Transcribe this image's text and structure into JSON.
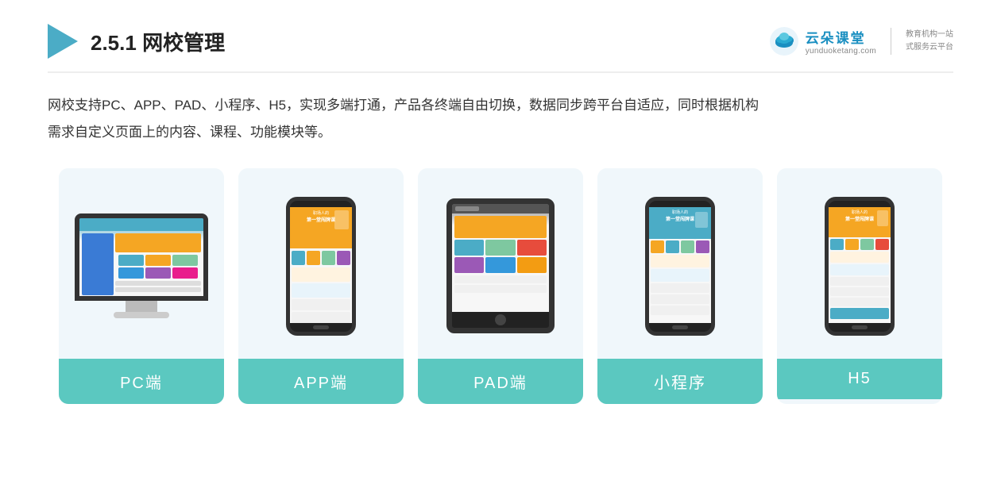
{
  "header": {
    "section_number": "2.5.1 ",
    "section_title": "网校管理",
    "brand_name": "云朵课堂",
    "brand_url": "yunduoketang.com",
    "brand_slogan_line1": "教育机构一站",
    "brand_slogan_line2": "式服务云平台"
  },
  "description": {
    "text_line1": "网校支持PC、APP、PAD、小程序、H5，实现多端打通，产品各终端自由切换，数据同步跨平台自适应，同时根据机构",
    "text_line2": "需求自定义页面上的内容、课程、功能模块等。"
  },
  "cards": [
    {
      "label": "PC端",
      "type": "pc"
    },
    {
      "label": "APP端",
      "type": "phone"
    },
    {
      "label": "PAD端",
      "type": "tablet"
    },
    {
      "label": "小程序",
      "type": "phone"
    },
    {
      "label": "H5",
      "type": "phone"
    }
  ]
}
